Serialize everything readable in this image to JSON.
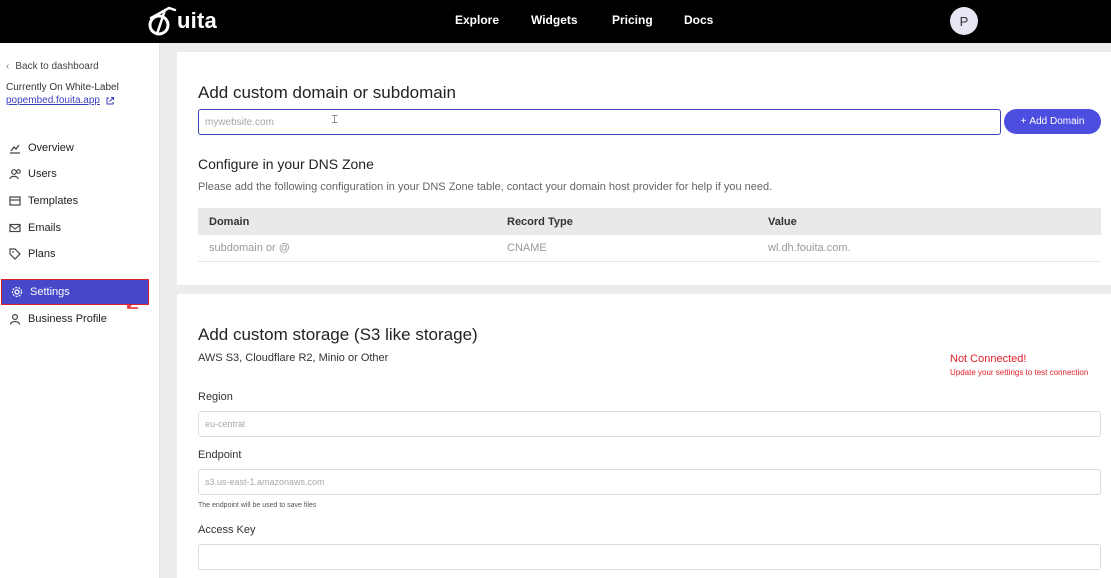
{
  "brand": {
    "name": "uita"
  },
  "nav": {
    "items": [
      "Explore",
      "Widgets",
      "Pricing",
      "Docs"
    ],
    "avatar_initial": "P"
  },
  "sidebar": {
    "back_label": "Back to dashboard",
    "current_label": "Currently On White-Label",
    "domain_link": "popembed.fouita.app",
    "items": [
      {
        "label": "Overview",
        "icon": "chart-icon"
      },
      {
        "label": "Users",
        "icon": "users-icon"
      },
      {
        "label": "Templates",
        "icon": "templates-icon"
      },
      {
        "label": "Emails",
        "icon": "mail-icon"
      },
      {
        "label": "Plans",
        "icon": "tag-icon"
      },
      {
        "label": "Settings",
        "icon": "gear-icon",
        "active": true
      },
      {
        "label": "Business Profile",
        "icon": "person-icon"
      }
    ],
    "accent_color": "#4648c9",
    "highlight_color": "#e0212a"
  },
  "domain_section": {
    "title": "Add custom domain or subdomain",
    "input_placeholder": "mywebsite.com",
    "add_button": "Add Domain",
    "add_button_icon": "+",
    "dns_title": "Configure in your DNS Zone",
    "dns_description": "Please add the following configuration in your DNS Zone table, contact your domain host provider for help if you need.",
    "table": {
      "headers": [
        "Domain",
        "Record Type",
        "Value"
      ],
      "rows": [
        [
          "subdomain or @",
          "CNAME",
          "wl.dh.fouita.com."
        ]
      ]
    }
  },
  "storage_section": {
    "title": "Add custom storage (S3 like storage)",
    "subtitle": "AWS S3, Cloudflare R2, Minio or Other",
    "status": "Not Connected!",
    "status_hint": "Update your settings to test connection",
    "fields": [
      {
        "label": "Region",
        "placeholder": "eu-central"
      },
      {
        "label": "Endpoint",
        "placeholder": "s3.us-east-1.amazonaws.com",
        "help": "The endpoint will be used to save files"
      },
      {
        "label": "Access Key",
        "placeholder": ""
      }
    ]
  }
}
